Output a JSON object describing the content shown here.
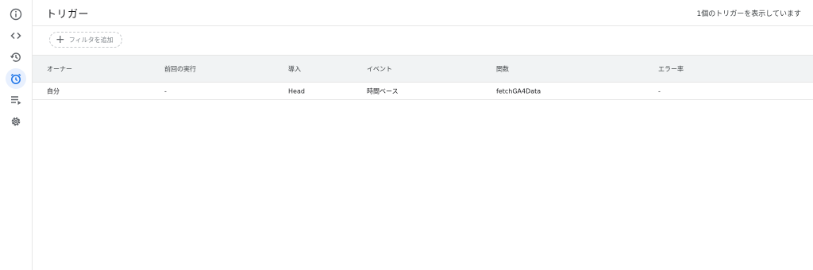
{
  "header": {
    "title": "トリガー",
    "summary": "1個のトリガーを表示しています"
  },
  "filter": {
    "label": "フィルタを追加"
  },
  "sidebar": {
    "items": [
      {
        "icon": "info-icon",
        "active": false
      },
      {
        "icon": "code-icon",
        "active": false
      },
      {
        "icon": "history-icon",
        "active": false
      },
      {
        "icon": "alarm-clock-icon",
        "active": true
      },
      {
        "icon": "executions-icon",
        "active": false
      },
      {
        "icon": "gear-icon",
        "active": false
      }
    ]
  },
  "table": {
    "columns": [
      "オーナー",
      "前回の実行",
      "導入",
      "イベント",
      "関数",
      "エラー率"
    ],
    "rows": [
      {
        "owner": "自分",
        "last_run": "-",
        "deployment": "Head",
        "event": "時間ベース",
        "function": "fetchGA4Data",
        "error_rate": "-"
      }
    ]
  },
  "colors": {
    "accent": "#1a73e8",
    "icon": "#5f6368",
    "header_bg": "#f1f3f4",
    "border": "#e6e6e6"
  }
}
